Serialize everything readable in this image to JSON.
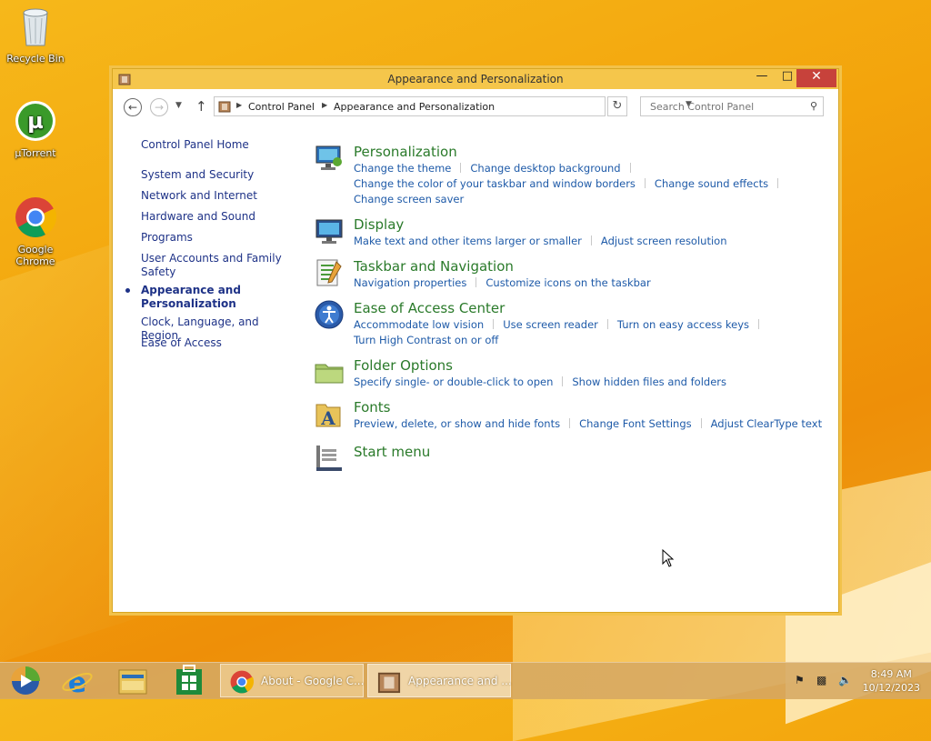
{
  "desktop": {
    "icons": [
      {
        "label": "Recycle Bin"
      },
      {
        "label": "µTorrent"
      },
      {
        "label": "Google Chrome"
      }
    ]
  },
  "window": {
    "title": "Appearance and Personalization",
    "close_glyph": "✕",
    "breadcrumb": [
      "Control Panel",
      "Appearance and Personalization"
    ],
    "search_placeholder": "Search Control Panel"
  },
  "sidebar": {
    "items": [
      {
        "label": "Control Panel Home"
      },
      {
        "label": "System and Security"
      },
      {
        "label": "Network and Internet"
      },
      {
        "label": "Hardware and Sound"
      },
      {
        "label": "Programs"
      },
      {
        "label": "User Accounts and Family Safety"
      },
      {
        "label": "Appearance and Personalization",
        "current": true
      },
      {
        "label": "Clock, Language, and Region"
      },
      {
        "label": "Ease of Access"
      }
    ]
  },
  "categories": [
    {
      "title": "Personalization",
      "icon": "personalization-icon",
      "links": [
        "Change the theme",
        "Change desktop background",
        "Change the color of your taskbar and window borders",
        "Change sound effects",
        "Change screen saver"
      ]
    },
    {
      "title": "Display",
      "icon": "display-icon",
      "links": [
        "Make text and other items larger or smaller",
        "Adjust screen resolution"
      ]
    },
    {
      "title": "Taskbar and Navigation",
      "icon": "taskbar-icon",
      "links": [
        "Navigation properties",
        "Customize icons on the taskbar"
      ]
    },
    {
      "title": "Ease of Access Center",
      "icon": "ease-of-access-icon",
      "links": [
        "Accommodate low vision",
        "Use screen reader",
        "Turn on easy access keys",
        "Turn High Contrast on or off"
      ]
    },
    {
      "title": "Folder Options",
      "icon": "folder-icon",
      "links": [
        "Specify single- or double-click to open",
        "Show hidden files and folders"
      ]
    },
    {
      "title": "Fonts",
      "icon": "fonts-icon",
      "links": [
        "Preview, delete, or show and hide fonts",
        "Change Font Settings",
        "Adjust ClearType text"
      ]
    },
    {
      "title": "Start menu",
      "icon": "start-menu-icon",
      "links": []
    }
  ],
  "taskbar": {
    "tasks": [
      {
        "label": "About - Google C..."
      },
      {
        "label": "Appearance and ..."
      }
    ],
    "time": "8:49 AM",
    "date": "10/12/2023"
  },
  "colors": {
    "category_title": "#2a7a2a",
    "link": "#1e5aa8",
    "nav": "#1e3287",
    "window_frame": "#f5c64b",
    "close_button": "#c7423b"
  }
}
